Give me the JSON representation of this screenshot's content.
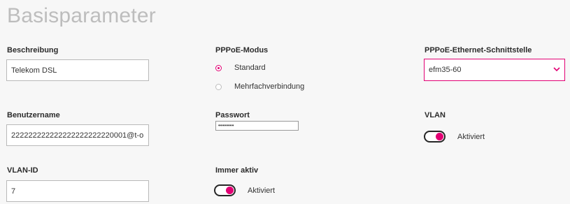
{
  "page": {
    "title": "Basisparameter"
  },
  "fields": {
    "beschreibung": {
      "label": "Beschreibung",
      "value": "Telekom DSL"
    },
    "pppoe_modus": {
      "label": "PPPoE-Modus",
      "options": [
        {
          "label": "Standard",
          "selected": true
        },
        {
          "label": "Mehrfachverbindung",
          "selected": false
        }
      ]
    },
    "schnittstelle": {
      "label": "PPPoE-Ethernet-Schnittstelle",
      "value": "efm35-60"
    },
    "benutzername": {
      "label": "Benutzername",
      "value": "222222222222222222222220001@t-o"
    },
    "passwort": {
      "label": "Passwort",
      "value": "••••••••"
    },
    "vlan": {
      "label": "VLAN",
      "toggle_label": "Aktiviert",
      "enabled": true
    },
    "vlan_id": {
      "label": "VLAN-ID",
      "value": "7"
    },
    "immer_aktiv": {
      "label": "Immer aktiv",
      "toggle_label": "Aktiviert",
      "enabled": true
    }
  },
  "colors": {
    "accent": "#e20074",
    "title": "#bdbdbd"
  }
}
